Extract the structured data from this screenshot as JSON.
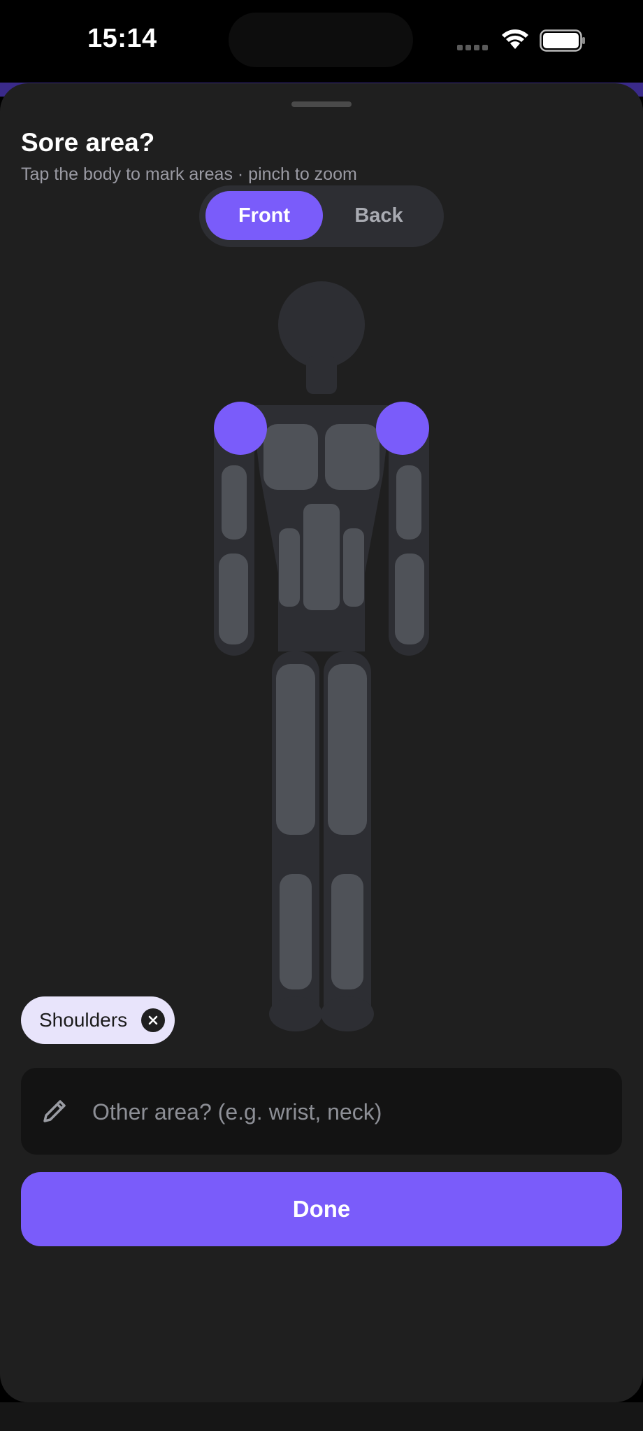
{
  "status_bar": {
    "time": "15:14"
  },
  "sheet": {
    "title": "Sore area?",
    "subtitle": "Tap the body to mark areas · pinch to zoom"
  },
  "view_toggle": {
    "front_label": "Front",
    "back_label": "Back",
    "selected": "Front"
  },
  "body_map": {
    "selected_regions": [
      "left-shoulder",
      "right-shoulder"
    ],
    "colors": {
      "selected": "#7a5cfa",
      "silhouette": "#2d2e33",
      "muscle": "#4f5258"
    }
  },
  "selected_chips": [
    {
      "label": "Shoulders"
    }
  ],
  "other_area": {
    "placeholder": "Other area? (e.g. wrist, neck)",
    "value": ""
  },
  "done_button": {
    "label": "Done"
  },
  "colors": {
    "accent": "#7a5cfa",
    "sheet_bg": "#1f1f1f",
    "chip_bg": "#e8e4fb"
  }
}
